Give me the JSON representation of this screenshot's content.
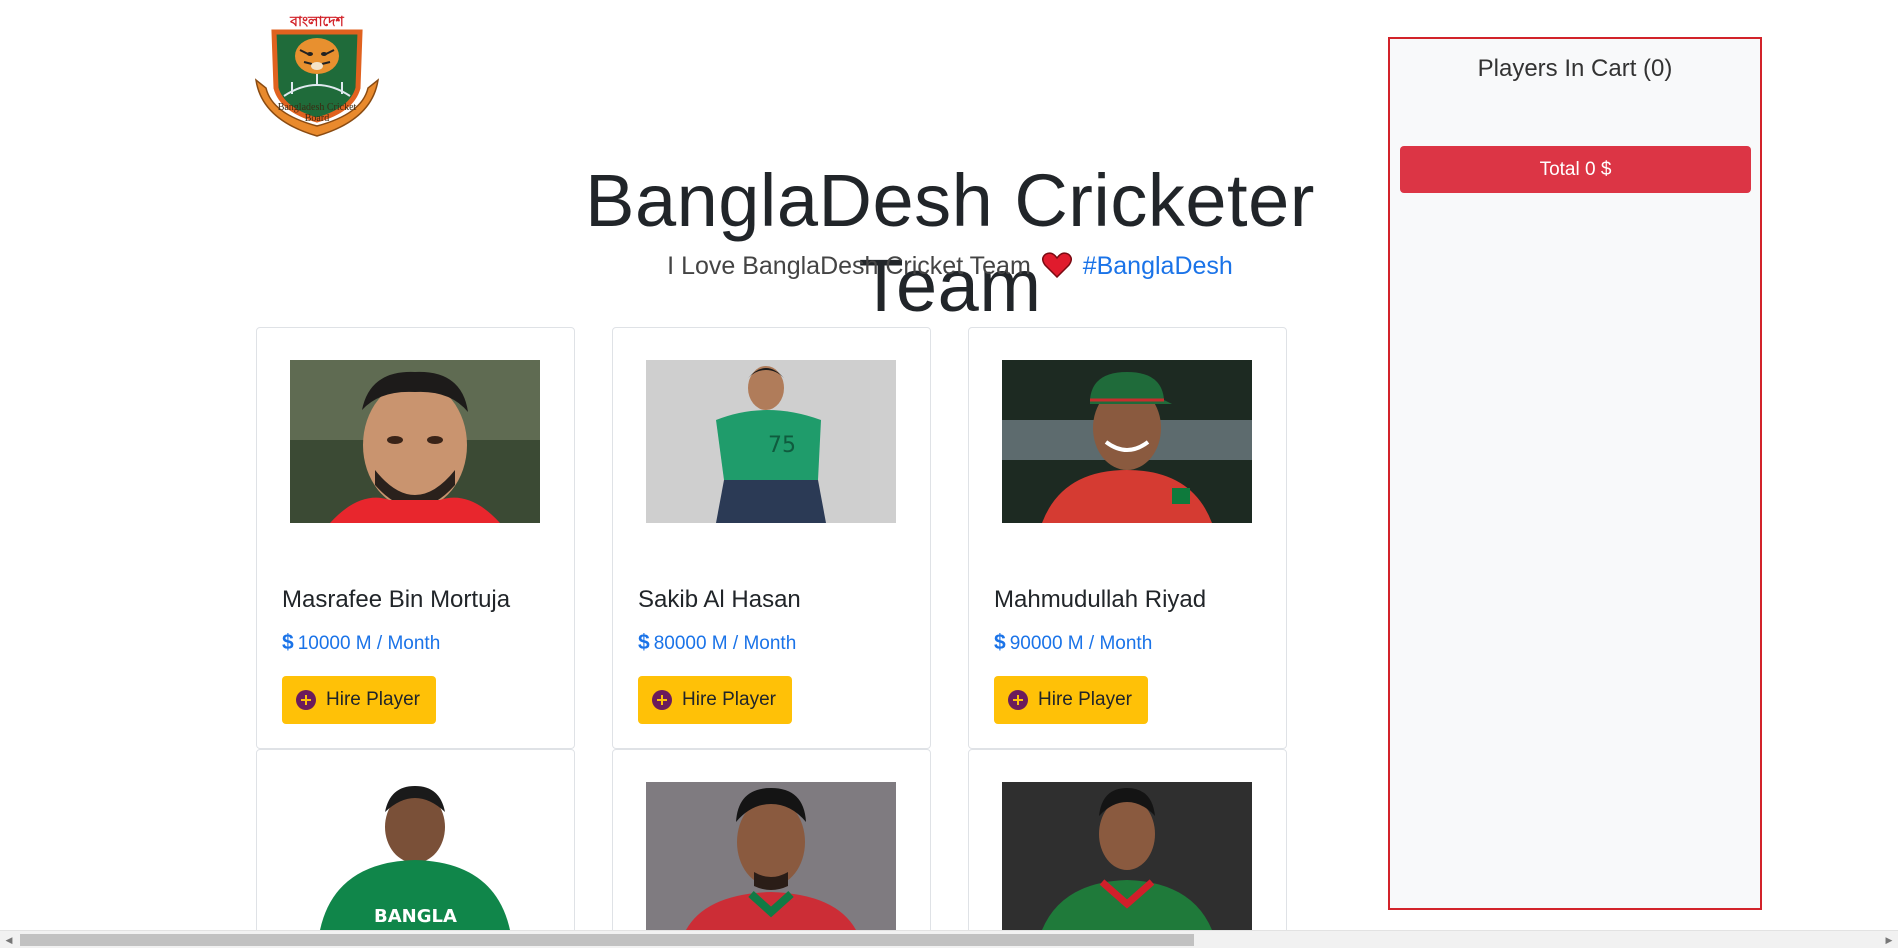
{
  "logo": {
    "top_text": "বাংলাদেশ",
    "banner_text": "Bangladesh Cricket Board"
  },
  "hero": {
    "title": "BanglaDesh Cricketer Team",
    "subtitle": "I Love BanglaDesh Cricket Team",
    "hashtag": "#BanglaDesh"
  },
  "players": [
    {
      "name": "Masrafee Bin Mortuja",
      "salary": "10000 M / Month",
      "button": "Hire Player",
      "shirt": "#e8262d"
    },
    {
      "name": "Sakib Al Hasan",
      "salary": "80000 M / Month",
      "button": "Hire Player",
      "shirt": "#1f9c6b"
    },
    {
      "name": "Mahmudullah Riyad",
      "salary": "90000 M / Month",
      "button": "Hire Player",
      "shirt": "#d53b32"
    },
    {
      "name": "",
      "salary": "",
      "button": "",
      "shirt": "#10864a"
    },
    {
      "name": "",
      "salary": "",
      "button": "",
      "shirt": "#cc2d36"
    },
    {
      "name": "",
      "salary": "",
      "button": "",
      "shirt": "#1f7a3a"
    }
  ],
  "cart": {
    "title": "Players In Cart (0)",
    "total_label": "Total 0 $"
  },
  "colors": {
    "accent_blue": "#1a73e8",
    "hire_yellow": "#ffc107",
    "cart_red": "#dc3545",
    "cart_border": "#d2232a"
  },
  "second_row_jersey_text": "BANGLA"
}
